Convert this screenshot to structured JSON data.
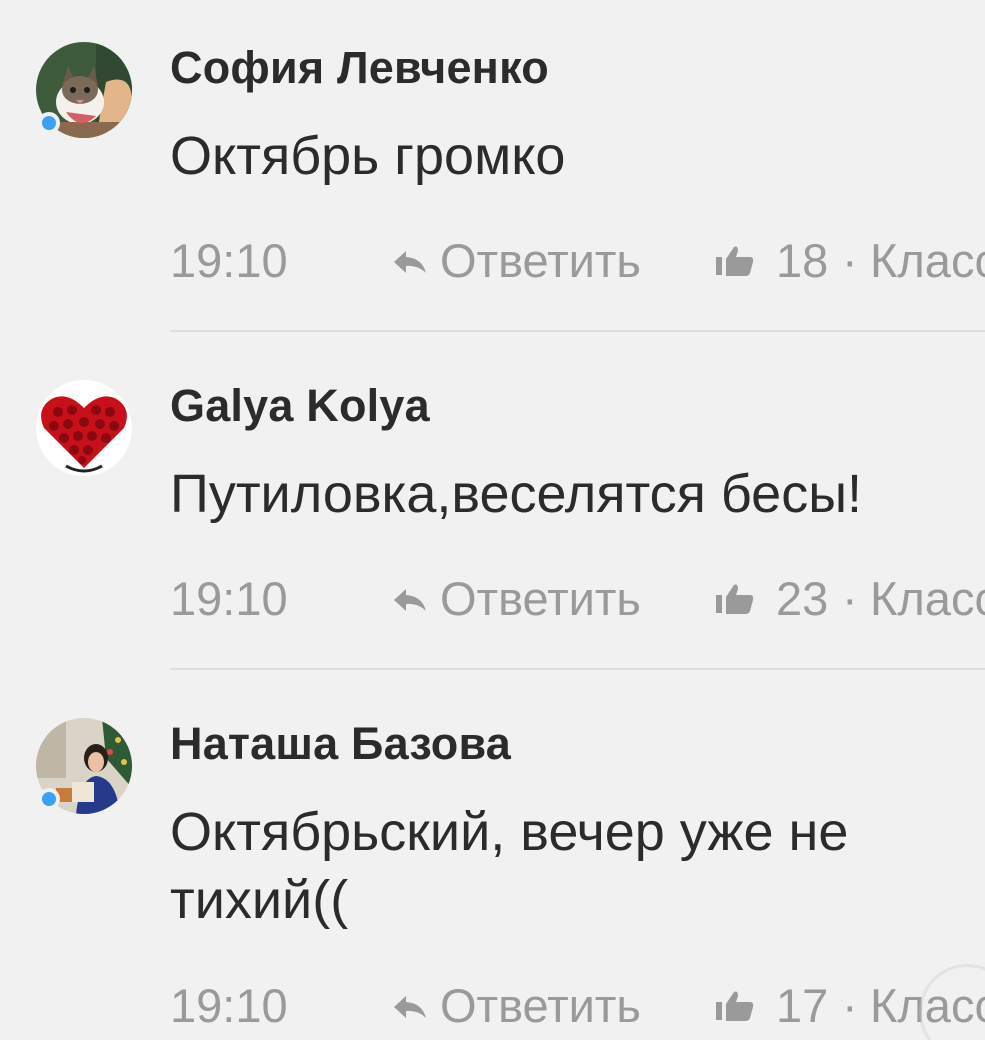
{
  "comments": [
    {
      "author": "София Левченко",
      "text": "Октябрь громко",
      "time": "19:10",
      "reply_label": "Ответить",
      "likes": "18",
      "separator": "·",
      "class_label": "Класс",
      "online": true,
      "avatar_icon": "cat-photo-avatar"
    },
    {
      "author": "Galya Kolya",
      "text": "Путиловка,веселятся бесы!",
      "time": "19:10",
      "reply_label": "Ответить",
      "likes": "23",
      "separator": "·",
      "class_label": "Класс",
      "online": false,
      "avatar_icon": "rose-heart-avatar"
    },
    {
      "author": "Наташа Базова",
      "text": "Октябрьский, вечер уже не\nтихий((",
      "time": "19:10",
      "reply_label": "Ответить",
      "likes": "17",
      "separator": "·",
      "class_label": "Класс",
      "online": true,
      "avatar_icon": "woman-photo-avatar"
    }
  ],
  "colors": {
    "background": "#f1f1f1",
    "text": "#2b2b2b",
    "meta": "#9a9a9a",
    "online_dot": "#3d9ff5",
    "divider": "#dedede"
  }
}
